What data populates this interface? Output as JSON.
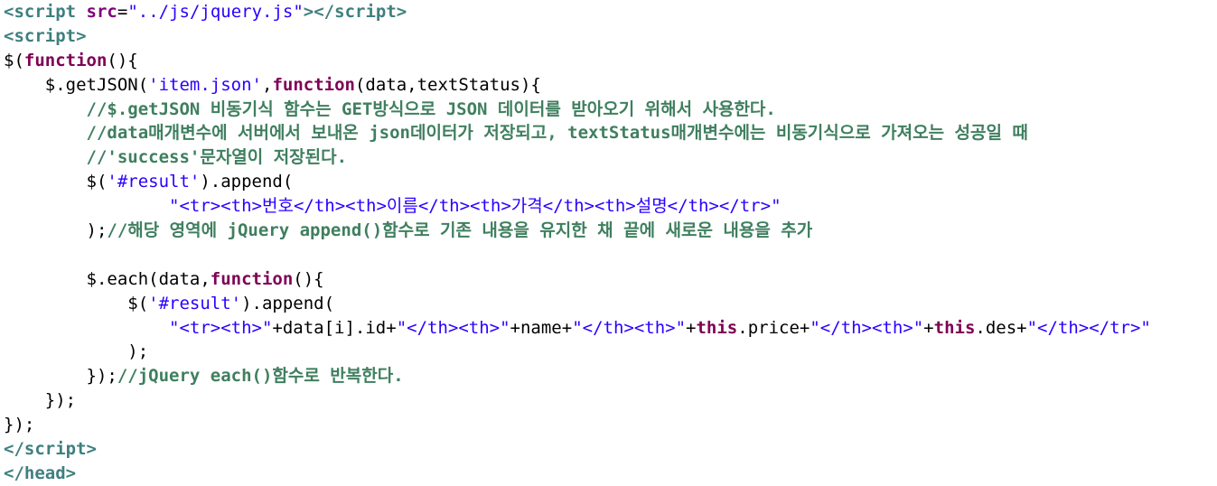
{
  "colors": {
    "default": "#000000",
    "tag": "#3f7f7f",
    "attr_name": "#7f007f",
    "keyword": "#7f0055",
    "string": "#2a00ff",
    "comment": "#3f7f5f"
  },
  "code": {
    "lines": [
      [
        {
          "t": "<",
          "k": "tag"
        },
        {
          "t": "script",
          "k": "tag"
        },
        {
          "t": " ",
          "k": "default"
        },
        {
          "t": "src",
          "k": "attr_name"
        },
        {
          "t": "=",
          "k": "default"
        },
        {
          "t": "\"../js/jquery.js\"",
          "k": "string"
        },
        {
          "t": "></",
          "k": "tag"
        },
        {
          "t": "script",
          "k": "tag"
        },
        {
          "t": ">",
          "k": "tag"
        }
      ],
      [
        {
          "t": "<",
          "k": "tag"
        },
        {
          "t": "script",
          "k": "tag"
        },
        {
          "t": ">",
          "k": "tag"
        }
      ],
      [
        {
          "t": "$(",
          "k": "default"
        },
        {
          "t": "function",
          "k": "keyword"
        },
        {
          "t": "(){",
          "k": "default"
        }
      ],
      [
        {
          "t": "    $.getJSON(",
          "k": "default"
        },
        {
          "t": "'item.json'",
          "k": "string"
        },
        {
          "t": ",",
          "k": "default"
        },
        {
          "t": "function",
          "k": "keyword"
        },
        {
          "t": "(data,textStatus){",
          "k": "default"
        }
      ],
      [
        {
          "t": "        //$.getJSON 비동기식 함수는 GET방식으로 JSON 데이터를 받아오기 위해서 사용한다.",
          "k": "comment"
        }
      ],
      [
        {
          "t": "        //data매개변수에 서버에서 보내온 json데이터가 저장되고, textStatus매개변수에는 비동기식으로 가져오는 성공일 때",
          "k": "comment"
        }
      ],
      [
        {
          "t": "        //'success'문자열이 저장된다.",
          "k": "comment"
        }
      ],
      [
        {
          "t": "        $(",
          "k": "default"
        },
        {
          "t": "'#result'",
          "k": "string"
        },
        {
          "t": ").append(",
          "k": "default"
        }
      ],
      [
        {
          "t": "                ",
          "k": "default"
        },
        {
          "t": "\"<tr><th>번호</th><th>이름</th><th>가격</th><th>설명</th></tr>\"",
          "k": "string"
        }
      ],
      [
        {
          "t": "        );",
          "k": "default"
        },
        {
          "t": "//해당 영역에 jQuery append()함수로 기존 내용을 유지한 채 끝에 새로운 내용을 추가",
          "k": "comment"
        }
      ],
      [
        {
          "t": "",
          "k": "default"
        }
      ],
      [
        {
          "t": "        $.each(data,",
          "k": "default"
        },
        {
          "t": "function",
          "k": "keyword"
        },
        {
          "t": "(){",
          "k": "default"
        }
      ],
      [
        {
          "t": "            $(",
          "k": "default"
        },
        {
          "t": "'#result'",
          "k": "string"
        },
        {
          "t": ").append(",
          "k": "default"
        }
      ],
      [
        {
          "t": "                ",
          "k": "default"
        },
        {
          "t": "\"<tr><th>\"",
          "k": "string"
        },
        {
          "t": "+data[i].id+",
          "k": "default"
        },
        {
          "t": "\"</th><th>\"",
          "k": "string"
        },
        {
          "t": "+name+",
          "k": "default"
        },
        {
          "t": "\"</th><th>\"",
          "k": "string"
        },
        {
          "t": "+",
          "k": "default"
        },
        {
          "t": "this",
          "k": "keyword"
        },
        {
          "t": ".price+",
          "k": "default"
        },
        {
          "t": "\"</th><th>\"",
          "k": "string"
        },
        {
          "t": "+",
          "k": "default"
        },
        {
          "t": "this",
          "k": "keyword"
        },
        {
          "t": ".des+",
          "k": "default"
        },
        {
          "t": "\"</th></tr>\"",
          "k": "string"
        }
      ],
      [
        {
          "t": "            );",
          "k": "default"
        }
      ],
      [
        {
          "t": "        });",
          "k": "default"
        },
        {
          "t": "//jQuery each()함수로 반복한다.",
          "k": "comment"
        }
      ],
      [
        {
          "t": "    });",
          "k": "default"
        }
      ],
      [
        {
          "t": "});",
          "k": "default"
        }
      ],
      [
        {
          "t": "</",
          "k": "tag"
        },
        {
          "t": "script",
          "k": "tag"
        },
        {
          "t": ">",
          "k": "tag"
        }
      ],
      [
        {
          "t": "</",
          "k": "tag"
        },
        {
          "t": "head",
          "k": "tag"
        },
        {
          "t": ">",
          "k": "tag"
        }
      ]
    ]
  }
}
